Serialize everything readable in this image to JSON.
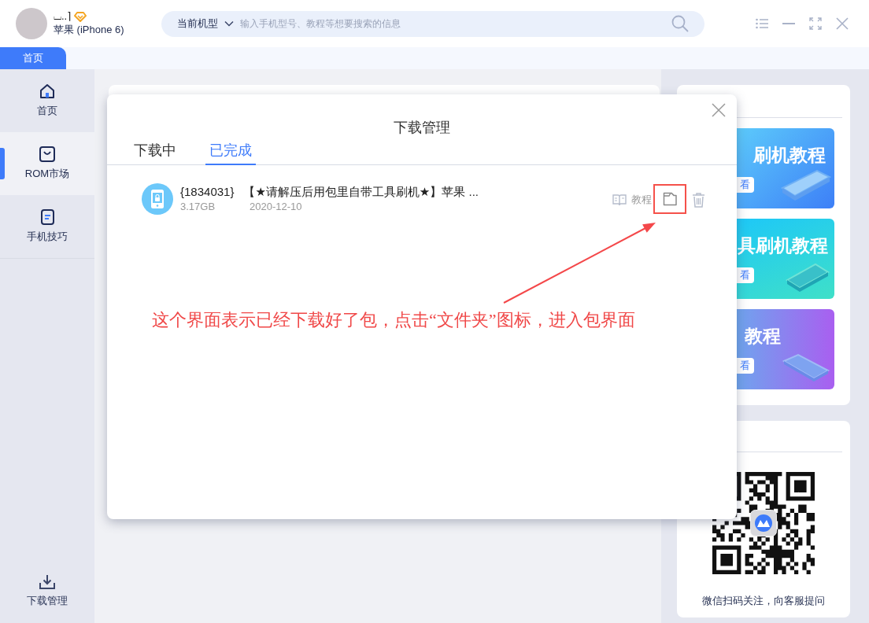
{
  "header": {
    "user": {
      "name": "⌴..⌉",
      "vip": true,
      "device": "苹果 (iPhone 6)"
    },
    "search": {
      "scope": "当前机型",
      "placeholder": "输入手机型号、教程等想要搜索的信息"
    }
  },
  "tabs": [
    {
      "label": "首页",
      "selected": true
    }
  ],
  "sidebar": {
    "items": [
      {
        "label": "首页",
        "selected": false
      },
      {
        "label": "ROM市场",
        "selected": true
      },
      {
        "label": "手机技巧",
        "selected": false
      }
    ],
    "footer": {
      "label": "下载管理"
    }
  },
  "dialog": {
    "title": "下载管理",
    "tabs": [
      {
        "label": "下载中",
        "selected": false
      },
      {
        "label": "已完成",
        "selected": true
      }
    ],
    "downloads": [
      {
        "id": "{1834031}",
        "name": "【★请解压后用包里自带工具刷机★】苹果 ...",
        "size": "3.17GB",
        "date": "2020-12-10",
        "tutorial": "教程"
      }
    ]
  },
  "annotation": {
    "text": "这个界面表示已经下载好了包，点击“文件夹”图标，进入包界面"
  },
  "banners": [
    {
      "title": "刷机教程",
      "button": "看"
    },
    {
      "title": "具刷机教程",
      "button": "看"
    },
    {
      "title": "教程",
      "button": "看"
    }
  ],
  "qr_card": {
    "caption": "微信扫码关注，向客服提问"
  }
}
